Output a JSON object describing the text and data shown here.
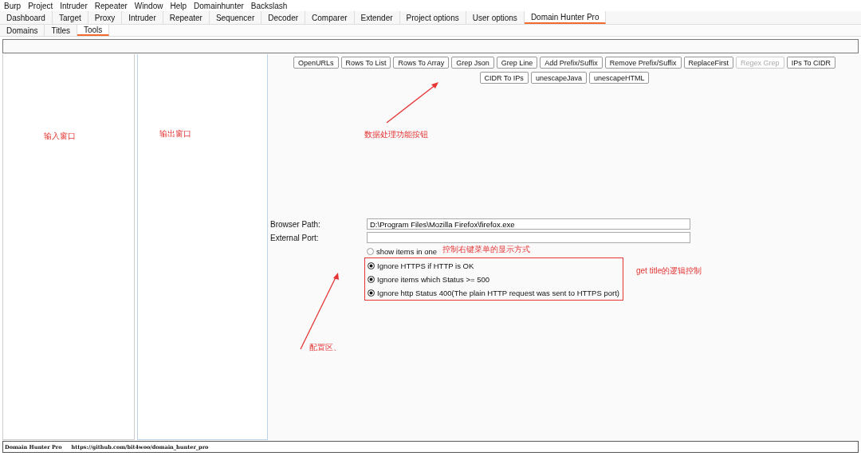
{
  "menu": [
    "Burp",
    "Project",
    "Intruder",
    "Repeater",
    "Window",
    "Help",
    "Domainhunter",
    "Backslash"
  ],
  "tabs": [
    {
      "label": "Dashboard",
      "selected": false
    },
    {
      "label": "Target",
      "selected": false
    },
    {
      "label": "Proxy",
      "selected": false
    },
    {
      "label": "Intruder",
      "selected": false
    },
    {
      "label": "Repeater",
      "selected": false
    },
    {
      "label": "Sequencer",
      "selected": false
    },
    {
      "label": "Decoder",
      "selected": false
    },
    {
      "label": "Comparer",
      "selected": false
    },
    {
      "label": "Extender",
      "selected": false
    },
    {
      "label": "Project options",
      "selected": false
    },
    {
      "label": "User options",
      "selected": false
    },
    {
      "label": "Domain Hunter Pro",
      "selected": true
    }
  ],
  "subtabs": [
    {
      "label": "Domains",
      "selected": false
    },
    {
      "label": "Titles",
      "selected": false
    },
    {
      "label": "Tools",
      "selected": true
    }
  ],
  "tool_buttons": [
    {
      "label": "OpenURLs",
      "disabled": false
    },
    {
      "label": "Rows To List",
      "disabled": false
    },
    {
      "label": "Rows To Array",
      "disabled": false
    },
    {
      "label": "Grep Json",
      "disabled": false
    },
    {
      "label": "Grep Line",
      "disabled": false
    },
    {
      "label": "Add Prefix/Suffix",
      "disabled": false
    },
    {
      "label": "Remove Prefix/Suffix",
      "disabled": false
    },
    {
      "label": "ReplaceFirst",
      "disabled": false
    },
    {
      "label": "Regex Grep",
      "disabled": true
    },
    {
      "label": "IPs To CIDR",
      "disabled": false
    },
    {
      "label": "CIDR To IPs",
      "disabled": false
    },
    {
      "label": "unescapeJava",
      "disabled": false
    },
    {
      "label": "unescapeHTML",
      "disabled": false
    }
  ],
  "config": {
    "fields": [
      {
        "label": "Browser Path:",
        "value": "D:\\Program Files\\Mozilla Firefox\\firefox.exe"
      },
      {
        "label": "External Port:"
      }
    ],
    "options": [
      {
        "label": "show items in one",
        "checked": false
      },
      {
        "label": "Ignore HTTPS if HTTP is OK",
        "checked": true
      },
      {
        "label": "Ignore items which Status >= 500",
        "checked": true
      },
      {
        "label": "Ignore http Status 400(The plain HTTP request was sent to HTTPS port)",
        "checked": true
      }
    ]
  },
  "annotations": [
    {
      "text": "输入窗口"
    },
    {
      "text": "输出窗口"
    },
    {
      "text": "数据处理功能按钮"
    },
    {
      "text": "控制右键菜单的显示方式"
    },
    {
      "text": "get title的逻辑控制"
    },
    {
      "text": "配置区、"
    }
  ],
  "status_bar": {
    "name": "Domain Hunter Pro",
    "url": "https://github.com/bit4woo/domain_hunter_pro"
  }
}
